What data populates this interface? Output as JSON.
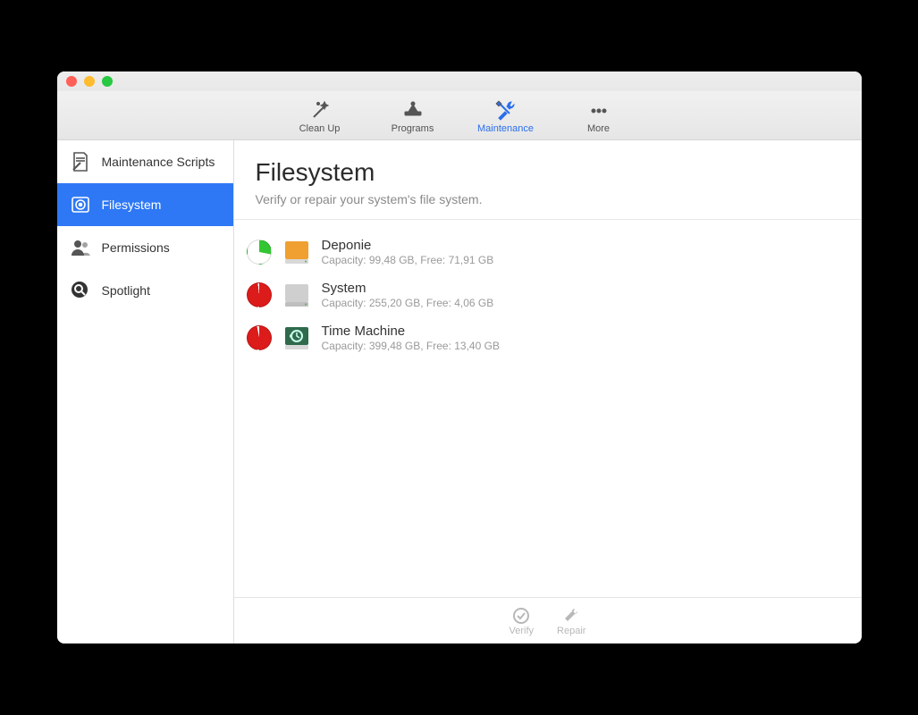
{
  "toolbar": {
    "cleanup": "Clean Up",
    "programs": "Programs",
    "maintenance": "Maintenance",
    "more": "More"
  },
  "sidebar": {
    "items": [
      {
        "label": "Maintenance Scripts"
      },
      {
        "label": "Filesystem"
      },
      {
        "label": "Permissions"
      },
      {
        "label": "Spotlight"
      }
    ],
    "active_index": 1
  },
  "header": {
    "title": "Filesystem",
    "subtitle": "Verify or repair your system's file system."
  },
  "volumes": [
    {
      "name": "Deponie",
      "info": "Capacity: 99,48 GB, Free: 71,91 GB",
      "used_fraction": 0.28,
      "pie_color": "#33c633",
      "icon": "orange-disk"
    },
    {
      "name": "System",
      "info": "Capacity: 255,20 GB, Free: 4,06 GB",
      "used_fraction": 0.98,
      "pie_color": "#dc1b1b",
      "icon": "silver-disk"
    },
    {
      "name": "Time Machine",
      "info": "Capacity: 399,48 GB, Free: 13,40 GB",
      "used_fraction": 0.97,
      "pie_color": "#dc1b1b",
      "icon": "tm-disk"
    }
  ],
  "footer": {
    "verify": "Verify",
    "repair": "Repair"
  }
}
